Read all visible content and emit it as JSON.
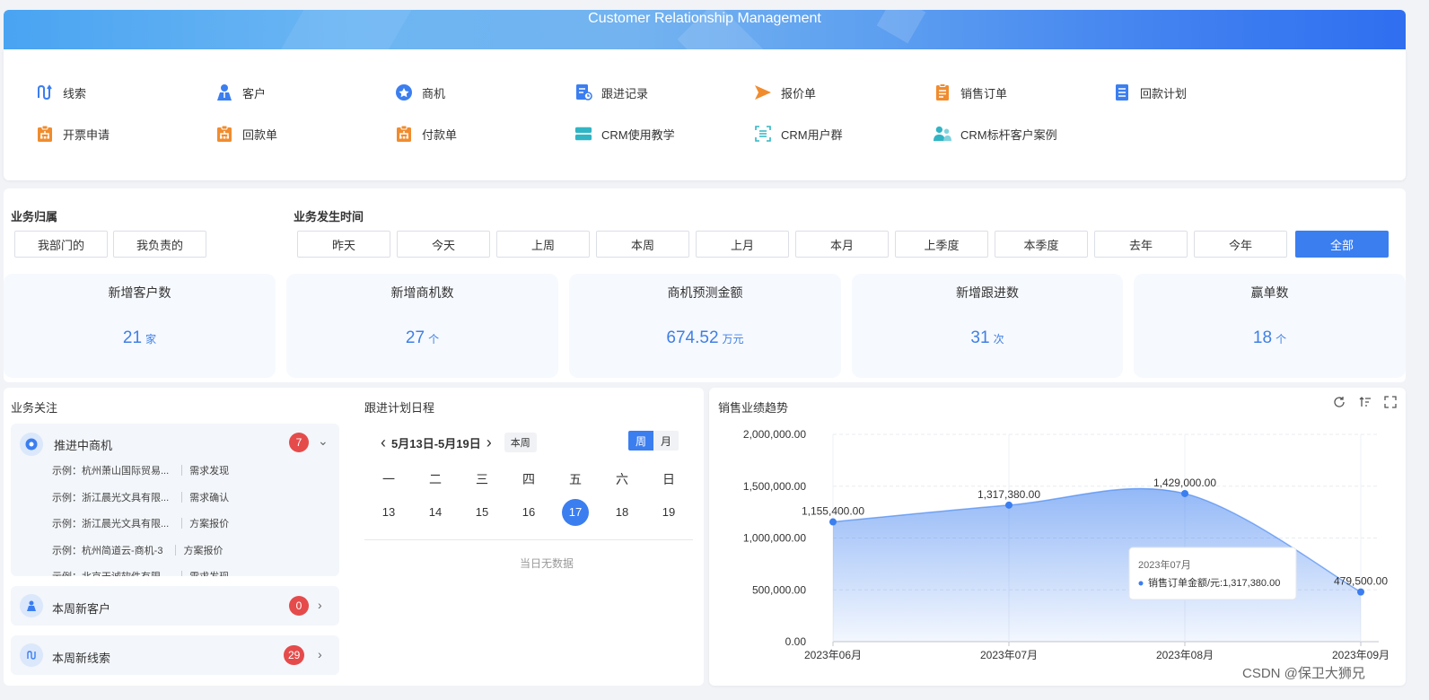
{
  "banner": {
    "title": "Customer Relationship Management"
  },
  "quick_links": [
    {
      "label": "线索",
      "icon": "clue-icon",
      "color": "#3b7ef0"
    },
    {
      "label": "客户",
      "icon": "customer-icon",
      "color": "#3b7ef0"
    },
    {
      "label": "商机",
      "icon": "opportunity-icon",
      "color": "#3b7ef0"
    },
    {
      "label": "跟进记录",
      "icon": "followup-record-icon",
      "color": "#3b7ef0"
    },
    {
      "label": "报价单",
      "icon": "quote-icon",
      "color": "#f08c2e"
    },
    {
      "label": "销售订单",
      "icon": "sales-order-icon",
      "color": "#f08c2e"
    },
    {
      "label": "回款计划",
      "icon": "payment-plan-icon",
      "color": "#3b7ef0"
    },
    {
      "label": "开票申请",
      "icon": "invoice-request-icon",
      "color": "#f08c2e"
    },
    {
      "label": "回款单",
      "icon": "payment-receipt-icon",
      "color": "#f08c2e"
    },
    {
      "label": "付款单",
      "icon": "payment-order-icon",
      "color": "#f08c2e"
    },
    {
      "label": "CRM使用教学",
      "icon": "tutorial-icon",
      "color": "#31b5c4"
    },
    {
      "label": "CRM用户群",
      "icon": "user-group-icon",
      "color": "#31b5c4"
    },
    {
      "label": "CRM标杆客户案例",
      "icon": "case-icon",
      "color": "#31b5c4"
    }
  ],
  "filters": {
    "ownership_label": "业务归属",
    "ownership_options": [
      "我部门的",
      "我负责的"
    ],
    "time_label": "业务发生时间",
    "time_options": [
      "昨天",
      "今天",
      "上周",
      "本周",
      "上月",
      "本月",
      "上季度",
      "本季度",
      "去年",
      "今年",
      "全部"
    ],
    "time_selected": "全部"
  },
  "stats": [
    {
      "label": "新增客户数",
      "value": "21",
      "unit": "家"
    },
    {
      "label": "新增商机数",
      "value": "27",
      "unit": "个"
    },
    {
      "label": "商机预测金额",
      "value": "674.52",
      "unit": "万元"
    },
    {
      "label": "新增跟进数",
      "value": "31",
      "unit": "次"
    },
    {
      "label": "赢单数",
      "value": "18",
      "unit": "个"
    }
  ],
  "focus": {
    "title": "业务关注",
    "opportunities": {
      "label": "推进中商机",
      "count": "7",
      "rows": [
        {
          "name": "示例：杭州萧山国际贸易...",
          "stage": "需求发现"
        },
        {
          "name": "示例：浙江晨光文具有限...",
          "stage": "需求确认"
        },
        {
          "name": "示例：浙江晨光文具有限...",
          "stage": "方案报价"
        },
        {
          "name": "示例：杭州简道云-商机-3",
          "stage": "方案报价"
        },
        {
          "name": "示例：北京天诚软件有限...",
          "stage": "需求发现"
        }
      ]
    },
    "new_customers": {
      "label": "本周新客户",
      "count": "0"
    },
    "new_clues": {
      "label": "本周新线索",
      "count": "29"
    }
  },
  "schedule": {
    "title": "跟进计划日程",
    "range": "5月13日-5月19日",
    "this_week": "本周",
    "view_week": "周",
    "view_month": "月",
    "weekdays": [
      "一",
      "二",
      "三",
      "四",
      "五",
      "六",
      "日"
    ],
    "days": [
      "13",
      "14",
      "15",
      "16",
      "17",
      "18",
      "19"
    ],
    "today": "17",
    "empty": "当日无数据"
  },
  "chart_data": {
    "type": "area",
    "title": "销售业绩趋势",
    "categories": [
      "2023年06月",
      "2023年07月",
      "2023年08月",
      "2023年09月"
    ],
    "series": [
      {
        "name": "销售订单金额/元",
        "values": [
          1155400,
          1317380,
          1429000,
          479500
        ],
        "color": "#3b7ef0"
      }
    ],
    "value_labels": [
      "1,155,400.00",
      "1,317,380.00",
      "1,429,000.00",
      "479,500.00"
    ],
    "y_ticks": [
      "0.00",
      "500,000.00",
      "1,000,000.00",
      "1,500,000.00",
      "2,000,000.00"
    ],
    "ylim": [
      0,
      2000000
    ],
    "grid": true,
    "tooltip": {
      "title": "2023年07月",
      "text": "销售订单金额/元:1,317,380.00"
    }
  },
  "watermark": "CSDN @保卫大狮兄"
}
